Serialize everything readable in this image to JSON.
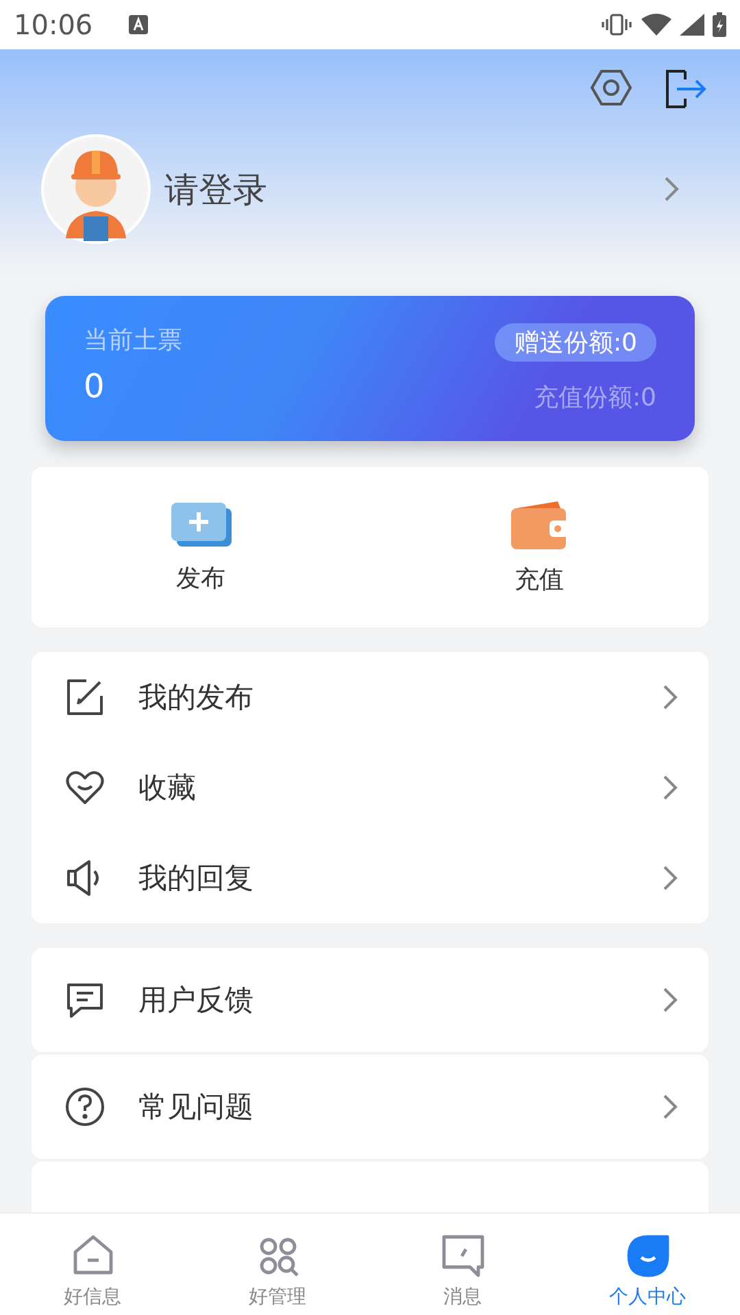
{
  "status_bar": {
    "time": "10:06"
  },
  "profile": {
    "name": "请登录"
  },
  "balance_card": {
    "label": "当前土票",
    "value": "0",
    "gift_quota": "赠送份额:0",
    "recharge_quota": "充值份额:0"
  },
  "quick_actions": [
    {
      "kind": "publish",
      "label": "发布"
    },
    {
      "kind": "recharge",
      "label": "充值"
    }
  ],
  "menu_groups": [
    {
      "items": [
        {
          "kind": "edit",
          "label": "我的发布"
        },
        {
          "kind": "heart",
          "label": "收藏"
        },
        {
          "kind": "speaker",
          "label": "我的回复"
        }
      ]
    },
    {
      "items": [
        {
          "kind": "chat",
          "label": "用户反馈"
        }
      ]
    },
    {
      "items": [
        {
          "kind": "question",
          "label": "常见问题"
        }
      ]
    }
  ],
  "tab_bar": [
    {
      "kind": "home",
      "label": "好信息",
      "selected": false
    },
    {
      "kind": "grid",
      "label": "好管理",
      "selected": false
    },
    {
      "kind": "message",
      "label": "消息",
      "selected": false
    },
    {
      "kind": "profile",
      "label": "个人中心",
      "selected": true
    }
  ]
}
